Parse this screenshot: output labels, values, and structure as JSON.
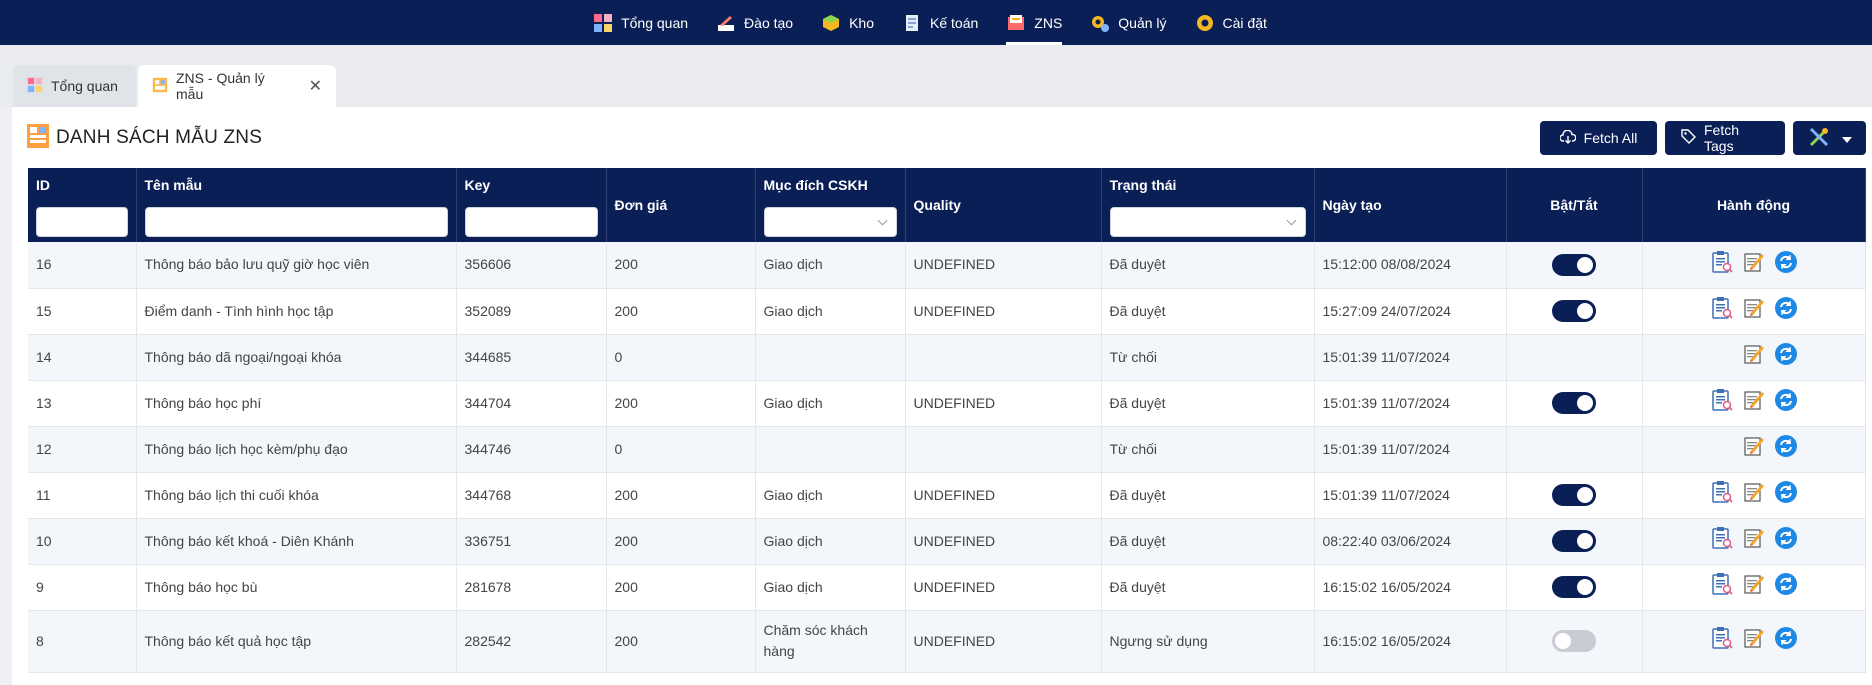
{
  "nav": {
    "items": [
      {
        "label": "Tổng quan",
        "icon": "dashboard-icon"
      },
      {
        "label": "Đào tạo",
        "icon": "training-icon"
      },
      {
        "label": "Kho",
        "icon": "warehouse-icon"
      },
      {
        "label": "Kế toán",
        "icon": "accounting-icon"
      },
      {
        "label": "ZNS",
        "icon": "zns-icon",
        "active": true
      },
      {
        "label": "Quản lý",
        "icon": "management-icon"
      },
      {
        "label": "Cài đặt",
        "icon": "settings-gear-icon"
      }
    ]
  },
  "tabs": [
    {
      "label": "Tổng quan",
      "icon": "dashboard-icon"
    },
    {
      "label": "ZNS - Quản lý mẫu",
      "icon": "template-list-icon",
      "active": true
    }
  ],
  "page": {
    "title": "DANH SÁCH MẪU ZNS",
    "fetch_all_label": "Fetch All",
    "fetch_tags_label": "Fetch Tags"
  },
  "table": {
    "headers": {
      "id": "ID",
      "name": "Tên mẫu",
      "key": "Key",
      "price": "Đơn giá",
      "purpose": "Mục đích CSKH",
      "quality": "Quality",
      "status": "Trạng thái",
      "created": "Ngày tạo",
      "toggle": "Bật/Tắt",
      "actions": "Hành động"
    },
    "rows": [
      {
        "id": "16",
        "name": "Thông báo bảo lưu quỹ giờ học viên",
        "key": "356606",
        "price": "200",
        "purpose": "Giao dịch",
        "quality": "UNDEFINED",
        "status": "Đã duyệt",
        "created": "15:12:00 08/08/2024",
        "toggle": "on",
        "preview": true
      },
      {
        "id": "15",
        "name": "Điểm danh - Tình hình học tập",
        "key": "352089",
        "price": "200",
        "purpose": "Giao dịch",
        "quality": "UNDEFINED",
        "status": "Đã duyệt",
        "created": "15:27:09 24/07/2024",
        "toggle": "on",
        "preview": true
      },
      {
        "id": "14",
        "name": "Thông báo dã ngoại/ngoại khóa",
        "key": "344685",
        "price": "0",
        "purpose": "",
        "quality": "",
        "status": "Từ chối",
        "created": "15:01:39 11/07/2024",
        "toggle": "none",
        "preview": false
      },
      {
        "id": "13",
        "name": "Thông báo học phí",
        "key": "344704",
        "price": "200",
        "purpose": "Giao dịch",
        "quality": "UNDEFINED",
        "status": "Đã duyệt",
        "created": "15:01:39 11/07/2024",
        "toggle": "on",
        "preview": true
      },
      {
        "id": "12",
        "name": "Thông báo lịch học kèm/phụ đạo",
        "key": "344746",
        "price": "0",
        "purpose": "",
        "quality": "",
        "status": "Từ chối",
        "created": "15:01:39 11/07/2024",
        "toggle": "none",
        "preview": false
      },
      {
        "id": "11",
        "name": "Thông báo lịch thi cuối khóa",
        "key": "344768",
        "price": "200",
        "purpose": "Giao dịch",
        "quality": "UNDEFINED",
        "status": "Đã duyệt",
        "created": "15:01:39 11/07/2024",
        "toggle": "on",
        "preview": true
      },
      {
        "id": "10",
        "name": "Thông báo kết khoá - Diên Khánh",
        "key": "336751",
        "price": "200",
        "purpose": "Giao dịch",
        "quality": "UNDEFINED",
        "status": "Đã duyệt",
        "created": "08:22:40 03/06/2024",
        "toggle": "on",
        "preview": true
      },
      {
        "id": "9",
        "name": "Thông báo học bù",
        "key": "281678",
        "price": "200",
        "purpose": "Giao dịch",
        "quality": "UNDEFINED",
        "status": "Đã duyệt",
        "created": "16:15:02 16/05/2024",
        "toggle": "on",
        "preview": true
      },
      {
        "id": "8",
        "name": "Thông báo kết quả học tập",
        "key": "282542",
        "price": "200",
        "purpose": "Chăm sóc khách hàng",
        "quality": "UNDEFINED",
        "status": "Ngưng sử dụng",
        "created": "16:15:02 16/05/2024",
        "toggle": "off",
        "preview": true
      }
    ]
  },
  "colors": {
    "primary": "#0b1f57",
    "refresh": "#1e88e5",
    "row_alt": "#f3f6fa"
  }
}
